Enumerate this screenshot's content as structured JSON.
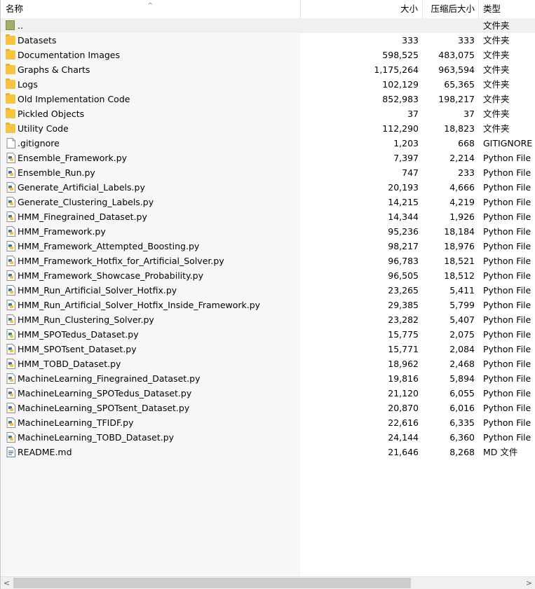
{
  "columns": {
    "name": "名称",
    "size": "大小",
    "packed": "压缩后大小",
    "type": "类型",
    "sort_arrow": "^"
  },
  "icons": {
    "folder": "folder-icon",
    "python": "python-file-icon",
    "text": "text-file-icon",
    "markdown": "markdown-file-icon",
    "up": "parent-directory-icon"
  },
  "rows": [
    {
      "name": "..",
      "size": "",
      "packed": "",
      "type": "文件夹",
      "kind": "up"
    },
    {
      "name": "Datasets",
      "size": "333",
      "packed": "333",
      "type": "文件夹",
      "kind": "folder"
    },
    {
      "name": "Documentation Images",
      "size": "598,525",
      "packed": "483,075",
      "type": "文件夹",
      "kind": "folder"
    },
    {
      "name": "Graphs & Charts",
      "size": "1,175,264",
      "packed": "963,594",
      "type": "文件夹",
      "kind": "folder"
    },
    {
      "name": "Logs",
      "size": "102,129",
      "packed": "65,365",
      "type": "文件夹",
      "kind": "folder"
    },
    {
      "name": "Old Implementation Code",
      "size": "852,983",
      "packed": "198,217",
      "type": "文件夹",
      "kind": "folder"
    },
    {
      "name": "Pickled Objects",
      "size": "37",
      "packed": "37",
      "type": "文件夹",
      "kind": "folder"
    },
    {
      "name": "Utility Code",
      "size": "112,290",
      "packed": "18,823",
      "type": "文件夹",
      "kind": "folder"
    },
    {
      "name": ".gitignore",
      "size": "1,203",
      "packed": "668",
      "type": "GITIGNORE 文件",
      "kind": "text"
    },
    {
      "name": "Ensemble_Framework.py",
      "size": "7,397",
      "packed": "2,214",
      "type": "Python File",
      "kind": "python"
    },
    {
      "name": "Ensemble_Run.py",
      "size": "747",
      "packed": "233",
      "type": "Python File",
      "kind": "python"
    },
    {
      "name": "Generate_Artificial_Labels.py",
      "size": "20,193",
      "packed": "4,666",
      "type": "Python File",
      "kind": "python"
    },
    {
      "name": "Generate_Clustering_Labels.py",
      "size": "14,215",
      "packed": "4,219",
      "type": "Python File",
      "kind": "python"
    },
    {
      "name": "HMM_Finegrained_Dataset.py",
      "size": "14,344",
      "packed": "1,926",
      "type": "Python File",
      "kind": "python"
    },
    {
      "name": "HMM_Framework.py",
      "size": "95,236",
      "packed": "18,184",
      "type": "Python File",
      "kind": "python"
    },
    {
      "name": "HMM_Framework_Attempted_Boosting.py",
      "size": "98,217",
      "packed": "18,976",
      "type": "Python File",
      "kind": "python"
    },
    {
      "name": "HMM_Framework_Hotfix_for_Artificial_Solver.py",
      "size": "96,783",
      "packed": "18,521",
      "type": "Python File",
      "kind": "python"
    },
    {
      "name": "HMM_Framework_Showcase_Probability.py",
      "size": "96,505",
      "packed": "18,512",
      "type": "Python File",
      "kind": "python"
    },
    {
      "name": "HMM_Run_Artificial_Solver_Hotfix.py",
      "size": "23,265",
      "packed": "5,411",
      "type": "Python File",
      "kind": "python"
    },
    {
      "name": "HMM_Run_Artificial_Solver_Hotfix_Inside_Framework.py",
      "size": "29,385",
      "packed": "5,799",
      "type": "Python File",
      "kind": "python"
    },
    {
      "name": "HMM_Run_Clustering_Solver.py",
      "size": "23,282",
      "packed": "5,407",
      "type": "Python File",
      "kind": "python"
    },
    {
      "name": "HMM_SPOTedus_Dataset.py",
      "size": "15,775",
      "packed": "2,075",
      "type": "Python File",
      "kind": "python"
    },
    {
      "name": "HMM_SPOTsent_Dataset.py",
      "size": "15,771",
      "packed": "2,084",
      "type": "Python File",
      "kind": "python"
    },
    {
      "name": "HMM_TOBD_Dataset.py",
      "size": "18,962",
      "packed": "2,468",
      "type": "Python File",
      "kind": "python"
    },
    {
      "name": "MachineLearning_Finegrained_Dataset.py",
      "size": "19,816",
      "packed": "5,894",
      "type": "Python File",
      "kind": "python"
    },
    {
      "name": "MachineLearning_SPOTedus_Dataset.py",
      "size": "21,120",
      "packed": "6,055",
      "type": "Python File",
      "kind": "python"
    },
    {
      "name": "MachineLearning_SPOTsent_Dataset.py",
      "size": "20,870",
      "packed": "6,016",
      "type": "Python File",
      "kind": "python"
    },
    {
      "name": "MachineLearning_TFIDF.py",
      "size": "22,616",
      "packed": "6,335",
      "type": "Python File",
      "kind": "python"
    },
    {
      "name": "MachineLearning_TOBD_Dataset.py",
      "size": "24,144",
      "packed": "6,360",
      "type": "Python File",
      "kind": "python"
    },
    {
      "name": "README.md",
      "size": "21,646",
      "packed": "8,268",
      "type": "MD 文件",
      "kind": "markdown"
    }
  ],
  "scrollbar": {
    "left_arrow": "<",
    "right_arrow": ">",
    "position": 0.0,
    "visible_fraction": 0.77
  }
}
